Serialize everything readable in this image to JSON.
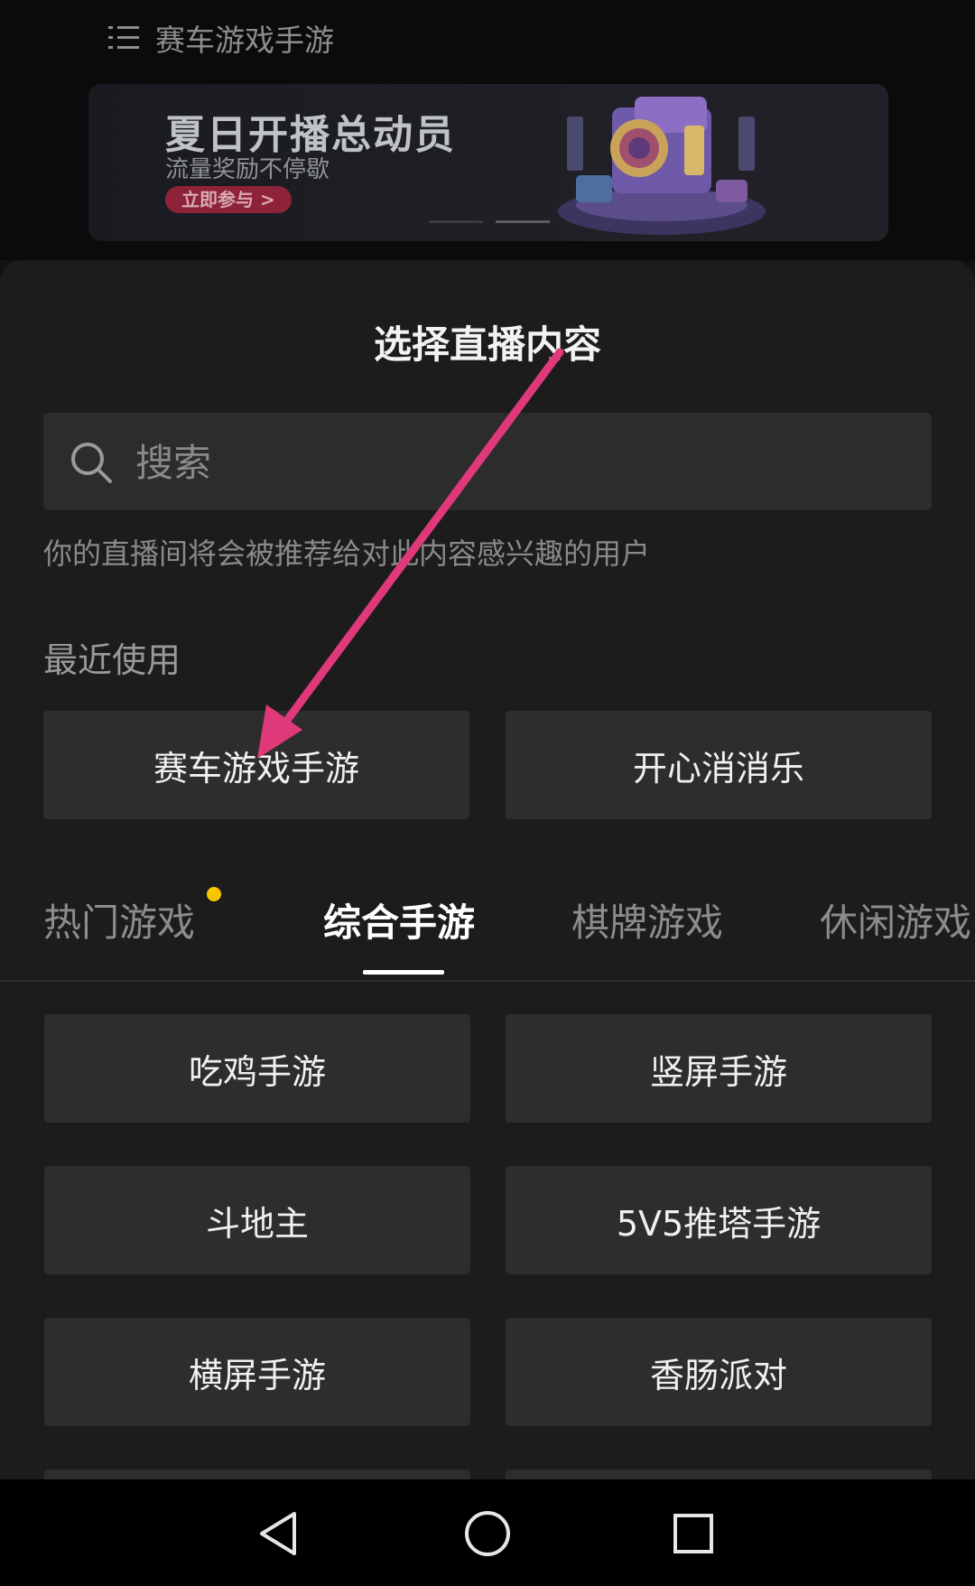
{
  "header": {
    "current_category": "赛车游戏手游",
    "list_icon": "list-icon"
  },
  "banner": {
    "title": "夏日开播总动员",
    "subtitle": "流量奖励不停歇",
    "button_label": "立即参与 >",
    "slide_count": 2,
    "active_slide": 2
  },
  "sheet": {
    "title": "选择直播内容",
    "search": {
      "placeholder": "搜索",
      "value": ""
    },
    "hint": "你的直播间将会被推荐给对此内容感兴趣的用户",
    "recent": {
      "label": "最近使用",
      "items": [
        "赛车游戏手游",
        "开心消消乐"
      ]
    },
    "tabs": [
      {
        "label": "热门游戏",
        "has_dot": true
      },
      {
        "label": "综合手游",
        "active": true
      },
      {
        "label": "棋牌游戏"
      },
      {
        "label": "休闲游戏"
      }
    ],
    "categories": [
      "吃鸡手游",
      "竖屏手游",
      "斗地主",
      "5V5推塔手游",
      "横屏手游",
      "香肠派对"
    ]
  },
  "colors": {
    "accent_arrow": "#e0397a",
    "tab_dot": "#f7c600",
    "background": "#1c1c1c",
    "chip": "#2d2d2d"
  },
  "navbar": {
    "icons": [
      "back-icon",
      "home-icon",
      "recents-icon"
    ]
  }
}
